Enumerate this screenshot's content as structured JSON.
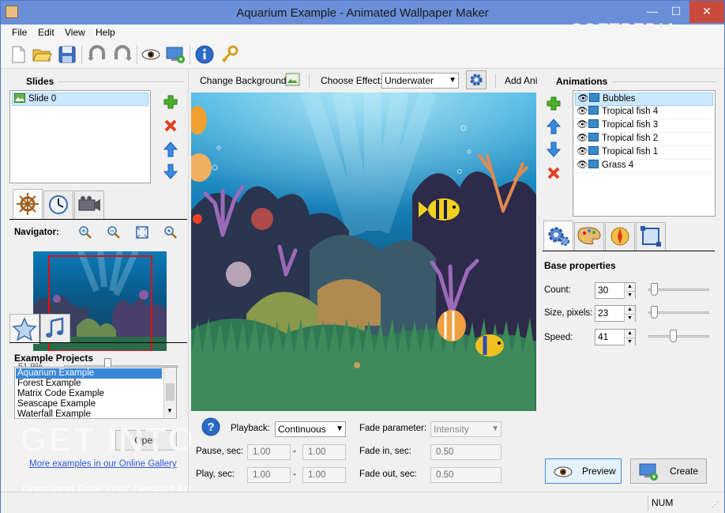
{
  "window": {
    "title": "Aquarium Example - Animated Wallpaper Maker",
    "minimize": "—",
    "maximize": "☐",
    "close": "✕"
  },
  "watermark": "SOFTPEDIA",
  "menu": [
    "File",
    "Edit",
    "View",
    "Help"
  ],
  "slides": {
    "title": "Slides",
    "items": [
      "Slide 0"
    ]
  },
  "navigator": {
    "label": "Navigator:",
    "zoom": "51.9%"
  },
  "example_projects": {
    "title": "Example Projects",
    "items": [
      "Aquarium Example",
      "Forest Example",
      "Matrix Code Example",
      "Seascape Example",
      "Waterfall Example"
    ],
    "open_label": "Open",
    "gallery_link": "More examples in our Online Gallery"
  },
  "effects_bar": {
    "change_background": "Change Background",
    "choose_effect_label": "Choose Effect:",
    "effect_value": "Underwater",
    "add_animation": "Add Anim"
  },
  "animations": {
    "title": "Animations",
    "items": [
      "Bubbles",
      "Tropical fish 4",
      "Tropical fish 3",
      "Tropical fish 2",
      "Tropical fish 1",
      "Grass 4"
    ]
  },
  "base_properties": {
    "title": "Base properties",
    "count_label": "Count:",
    "count_value": "30",
    "size_label": "Size, pixels:",
    "size_value": "23",
    "speed_label": "Speed:",
    "speed_value": "41"
  },
  "playback": {
    "label": "Playback:",
    "value": "Continuous",
    "pause_label": "Pause, sec:",
    "pause_from": "1.00",
    "pause_to": "1.00",
    "play_label": "Play, sec:",
    "play_from": "1.00",
    "play_to": "1.00",
    "dash": "-",
    "fade_param_label": "Fade parameter:",
    "fade_param_value": "Intensity",
    "fade_in_label": "Fade in, sec:",
    "fade_in_value": "0.50",
    "fade_out_label": "Fade out, sec:",
    "fade_out_value": "0.50"
  },
  "actions": {
    "preview": "Preview",
    "create": "Create"
  },
  "status": {
    "num": "NUM"
  },
  "overlay": {
    "brand": "GET INTO PC",
    "tagline": "Download Free Your Desired App"
  }
}
